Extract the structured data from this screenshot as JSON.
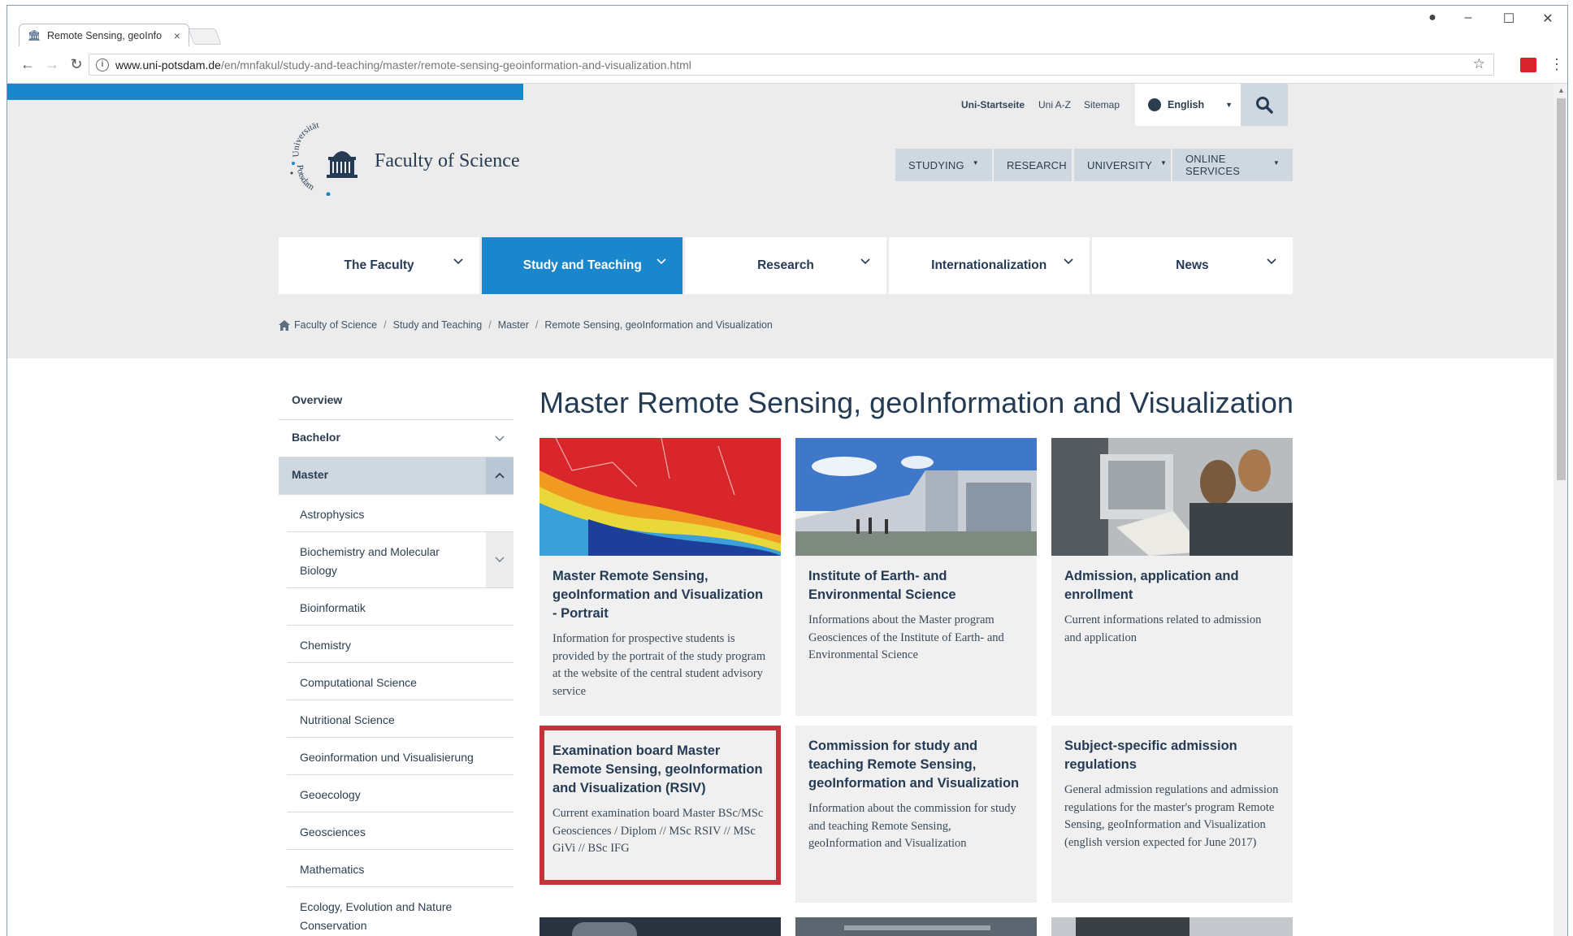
{
  "browser": {
    "tab_title": "Remote Sensing, geoInfo",
    "tab_close": "×",
    "url_host": "www.uni-potsdam.de",
    "url_path": "/en/mnfakul/study-and-teaching/master/remote-sensing-geoinformation-and-visualization.html"
  },
  "util": {
    "links": [
      "Uni-Startseite",
      "Uni A-Z",
      "Sitemap"
    ],
    "language": "English"
  },
  "logo": {
    "title": "Faculty of Science",
    "arc_top": "Universität",
    "arc_bottom": "Potsdam"
  },
  "topmenu": [
    "STUDYING",
    "RESEARCH",
    "UNIVERSITY",
    "ONLINE SERVICES"
  ],
  "mainnav": [
    "The Faculty",
    "Study and Teaching",
    "Research",
    "Internationalization",
    "News"
  ],
  "breadcrumb": [
    "Faculty of Science",
    "Study and Teaching",
    "Master",
    "Remote Sensing, geoInformation and Visualization"
  ],
  "sidebar": {
    "top": [
      "Overview",
      "Bachelor",
      "Master"
    ],
    "sub": [
      "Astrophysics",
      "Biochemistry and Molecular Biology",
      "Bioinformatik",
      "Chemistry",
      "Computational Science",
      "Nutritional Science",
      "Geoinformation und Visualisierung",
      "Geoecology",
      "Geosciences",
      "Mathematics",
      "Ecology, Evolution and Nature Conservation"
    ]
  },
  "page_title": "Master Remote Sensing, geoInformation and Visualization",
  "cards": [
    {
      "title": "Master Remote Sensing, geoInformation and Visualization - Portrait",
      "text": "Information for prospective students is provided by the portrait of the study program at the website of the central student advisory service"
    },
    {
      "title": "Institute of Earth- and Environmental Science",
      "text": "Informations about the Master program Geosciences of the Institute of Earth- and Environmental Science"
    },
    {
      "title": "Admission, application and enrollment",
      "text": "Current informations related to admission and application"
    },
    {
      "title": "Examination board Master Remote Sensing, geoInformation and Visualization (RSIV)",
      "text": "Current examination board Master BSc/MSc Geosciences / Diplom // MSc RSIV // MSc GiVi // BSc IFG"
    },
    {
      "title": "Commission for study and teaching Remote Sensing, geoInformation and Visualization",
      "text": "Information about the commission for study and teaching Remote Sensing, geoInformation and Visualization"
    },
    {
      "title": "Subject-specific admission regulations",
      "text": "General admission regulations and admission regulations for the master's program Remote Sensing, geoInformation and Visualization (english version expected for June 2017)"
    }
  ],
  "colors": {
    "accent": "#1a86cc",
    "navy": "#253b54",
    "highlight": "#c0353a",
    "band": "#ececec",
    "nav_gray": "#cfd8e1"
  },
  "icons": [
    "home-icon",
    "search-icon",
    "globe-icon",
    "chevron-down-icon",
    "chevron-up-icon",
    "star-icon",
    "info-icon"
  ]
}
